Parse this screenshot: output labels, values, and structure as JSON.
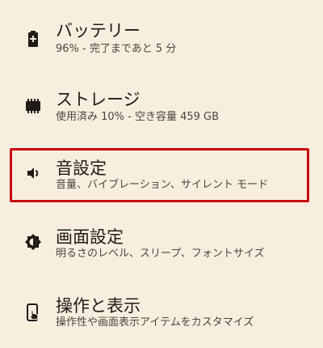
{
  "settings": {
    "items": [
      {
        "icon": "battery-icon",
        "title": "バッテリー",
        "summary": "96% - 完了まであと 5 分"
      },
      {
        "icon": "storage-icon",
        "title": "ストレージ",
        "summary": "使用済み 10% - 空き容量 459 GB"
      },
      {
        "icon": "volume-icon",
        "title": "音設定",
        "summary": "音量、バイブレーション、サイレント モード"
      },
      {
        "icon": "brightness-icon",
        "title": "画面設定",
        "summary": "明るさのレベル、スリープ、フォントサイズ"
      },
      {
        "icon": "accessibility-touch-icon",
        "title": "操作と表示",
        "summary": "操作性や画面表示アイテムをカスタマイズ"
      }
    ]
  },
  "colors": {
    "background": "#f8eedf",
    "highlight": "#c8070d",
    "text_primary": "#1f1b16",
    "text_secondary": "#4a453f"
  }
}
